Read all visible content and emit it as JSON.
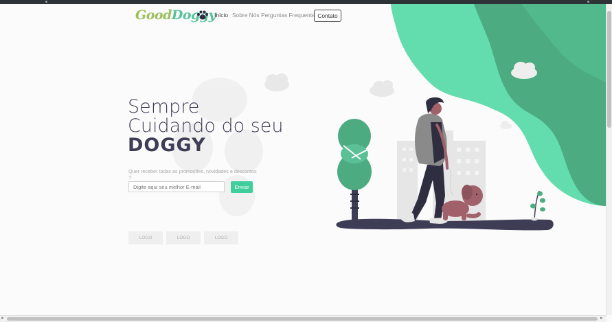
{
  "brand": {
    "part1": "Good",
    "part2": "Doggy"
  },
  "nav": {
    "links": [
      "Início",
      "Sobre Nós",
      "Perguntas Frequentes"
    ],
    "contact": "Contato"
  },
  "hero": {
    "line1": "Sempre",
    "line2": "Cuidando do seu",
    "line3": "DOGGY"
  },
  "newsletter": {
    "prompt": "Quer receber todas as promoções, novidades e descontos ?",
    "placeholder": "Digite aqui seu melhor E-mail",
    "button": "Enviar"
  },
  "partners": [
    "LOGO",
    "LOGO",
    "LOGO"
  ],
  "colors": {
    "brand_green": "#56c29a",
    "brand_lime": "#9cc15c",
    "accent": "#3fce9c",
    "text_dark": "#3f3d56",
    "doggy_pink": "#a0616a"
  },
  "icons": [
    "paw-icon",
    "cloud-icon",
    "tree-icon",
    "plant-icon",
    "person-icon",
    "dog-icon"
  ]
}
